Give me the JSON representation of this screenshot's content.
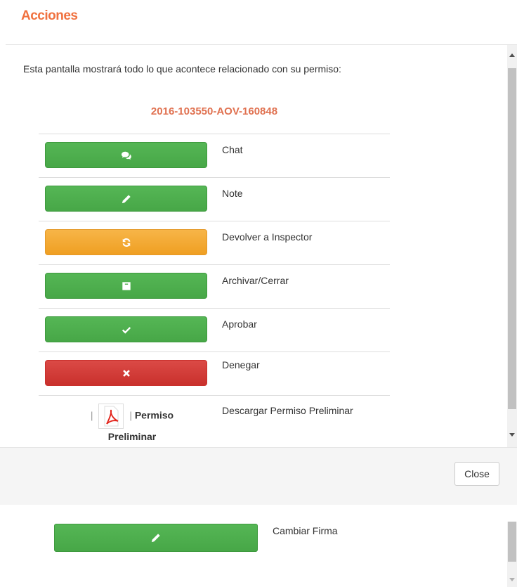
{
  "modal": {
    "title": "Acciones",
    "intro_text": "Esta pantalla mostrará todo lo que acontece relacionado con su permiso:",
    "permit_number": "2016-103550-AOV-160848",
    "actions": [
      {
        "icon": "chat-icon",
        "label": "Chat",
        "color": "#4cae4c"
      },
      {
        "icon": "pencil-icon",
        "label": "Note",
        "color": "#4cae4c"
      },
      {
        "icon": "refresh-icon",
        "label": "Devolver a Inspector",
        "color": "#f0ad4e"
      },
      {
        "icon": "archive-icon",
        "label": "Archivar/Cerrar",
        "color": "#4cae4c"
      },
      {
        "icon": "check-icon",
        "label": "Aprobar",
        "color": "#4cae4c"
      },
      {
        "icon": "times-icon",
        "label": "Denegar",
        "color": "#d9534f"
      }
    ],
    "pdf_download": {
      "separator": "|",
      "link_text_1": "Permiso",
      "link_text_2": "Preliminar",
      "label": "Descargar Permiso Preliminar",
      "icon": "pdf-icon"
    },
    "footer": {
      "close_label": "Close"
    }
  },
  "background": {
    "action": {
      "icon": "pencil-icon",
      "label": "Cambiar Firma",
      "color": "#4cae4c"
    }
  },
  "colors": {
    "title": "#f0713f",
    "permit_number": "#e07150"
  }
}
